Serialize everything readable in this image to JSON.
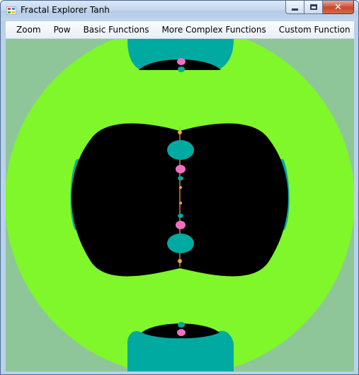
{
  "window": {
    "title": "Fractal Explorer Tanh",
    "app_icon": "windows-forms-app-icon",
    "controls": {
      "minimize_icon": "minimize-icon",
      "maximize_icon": "maximize-icon",
      "close_icon": "close-icon",
      "close_glyph": "✕"
    }
  },
  "menu": {
    "items": [
      {
        "label": "Zoom"
      },
      {
        "label": "Pow"
      },
      {
        "label": "Basic Functions"
      },
      {
        "label": "More Complex Functions"
      },
      {
        "label": "Custom Function"
      }
    ]
  },
  "fractal": {
    "colors": {
      "background": "#8ec69a",
      "outer_region": "#7ff72a",
      "teal": "#00aaa0",
      "interior": "#000000",
      "pink": "#f26fc0",
      "orange": "#f0a050"
    }
  }
}
